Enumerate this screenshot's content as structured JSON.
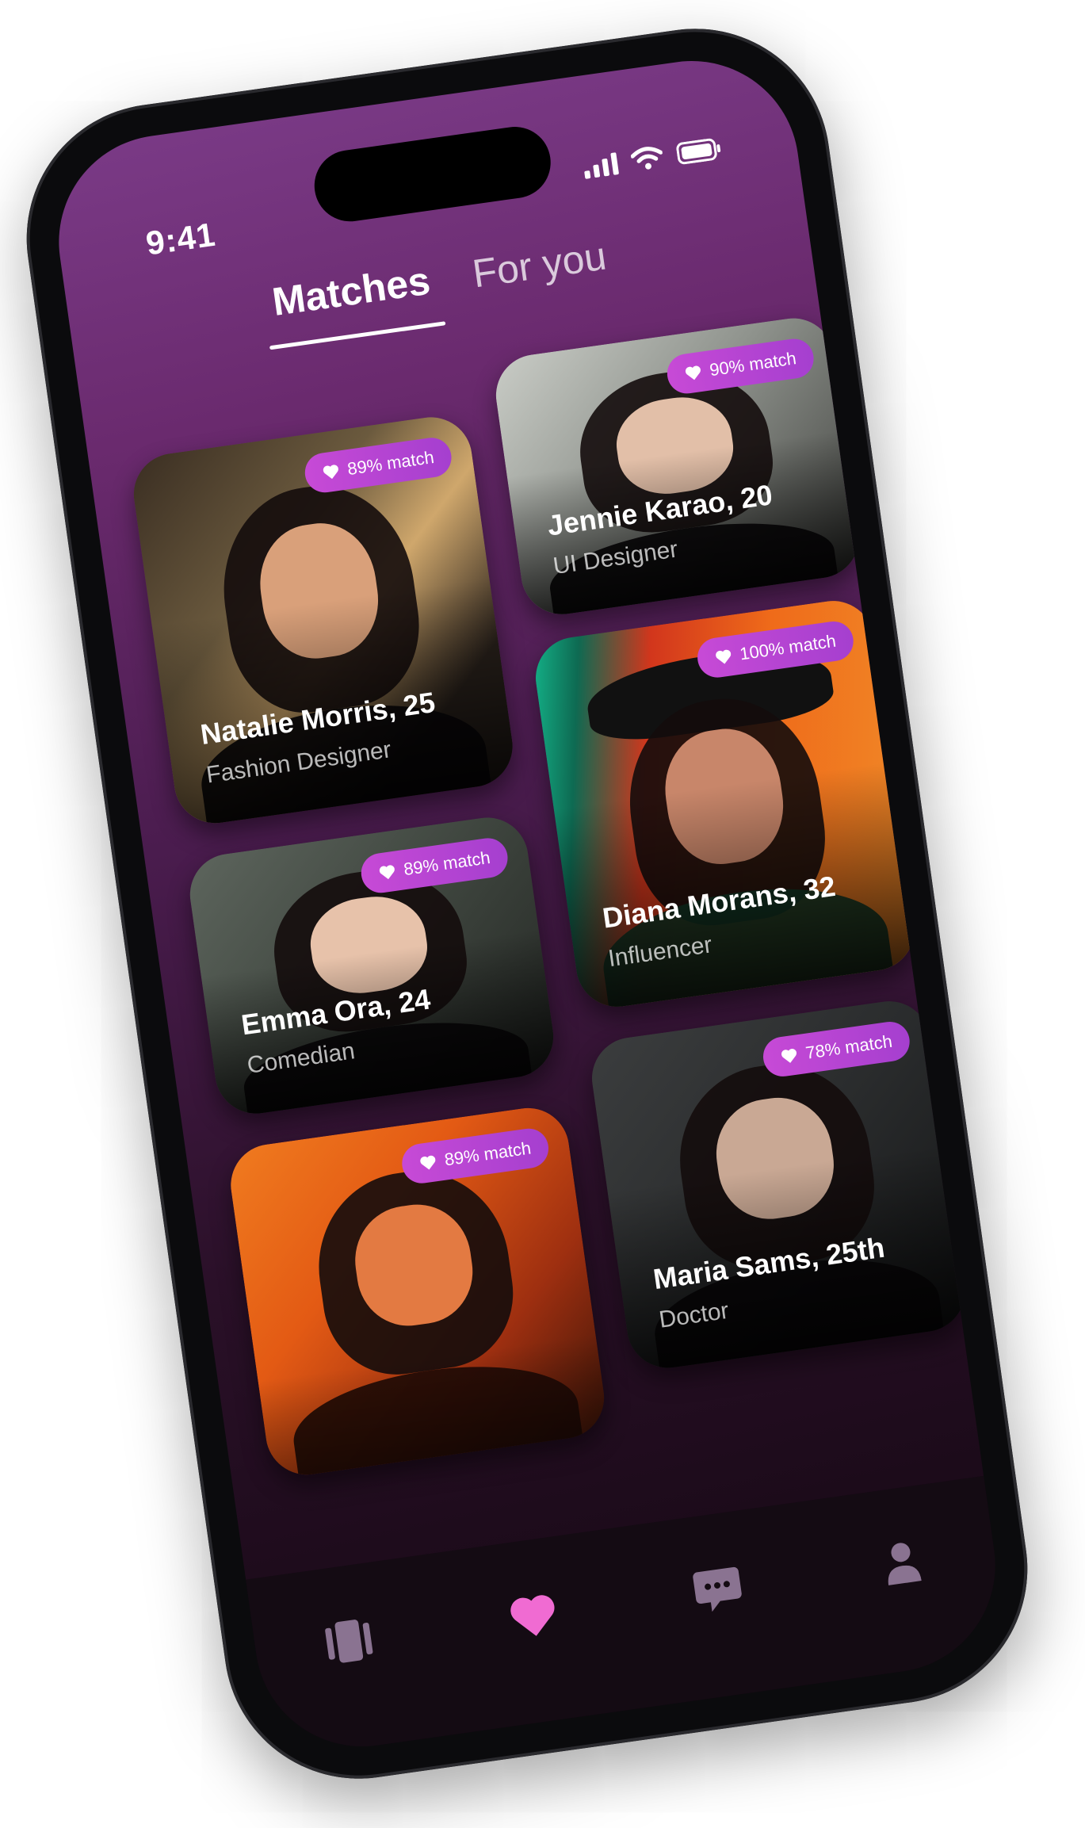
{
  "status_bar": {
    "time": "9:41"
  },
  "tabs": [
    {
      "label": "Matches",
      "active": true
    },
    {
      "label": "For you",
      "active": false
    }
  ],
  "colors": {
    "badge": "#c74ad6",
    "accent_heart": "#f06bd2",
    "nav_inactive": "#8a7391",
    "background_top": "#7a3a86",
    "background_bottom": "#140812"
  },
  "profiles": [
    {
      "name": "Natalie Morris, 25",
      "role": "Fashion Designer",
      "match": "89% match"
    },
    {
      "name": "Jennie Karao, 20",
      "role": "UI Designer",
      "match": "90% match"
    },
    {
      "name": "Diana Morans, 32",
      "role": "Influencer",
      "match": "100% match"
    },
    {
      "name": "Emma Ora, 24",
      "role": "Comedian",
      "match": "89% match"
    },
    {
      "name": "",
      "role": "",
      "match": "89% match"
    },
    {
      "name": "Maria Sams, 25th",
      "role": "Doctor",
      "match": "78% match"
    }
  ],
  "nav": [
    {
      "icon": "cards-icon",
      "active": false
    },
    {
      "icon": "heart-icon",
      "active": true
    },
    {
      "icon": "chat-icon",
      "active": false
    },
    {
      "icon": "profile-icon",
      "active": false
    }
  ]
}
